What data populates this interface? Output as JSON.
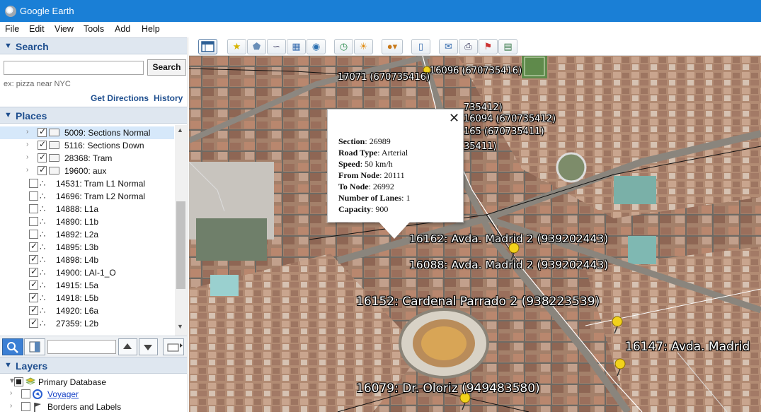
{
  "window": {
    "title": "Google Earth"
  },
  "menu": [
    "File",
    "Edit",
    "View",
    "Tools",
    "Add",
    "Help"
  ],
  "search": {
    "header": "Search",
    "input_value": "",
    "button": "Search",
    "hint": "ex: pizza near NYC",
    "get_directions": "Get Directions",
    "history": "History"
  },
  "places": {
    "header": "Places",
    "items": [
      {
        "label": "5009: Sections Normal",
        "checked": true,
        "kind": "folder",
        "expandable": true,
        "selected": true
      },
      {
        "label": "5116: Sections Down",
        "checked": true,
        "kind": "folder",
        "expandable": true
      },
      {
        "label": "28368: Tram",
        "checked": true,
        "kind": "folder",
        "expandable": true
      },
      {
        "label": "19600: aux",
        "checked": true,
        "kind": "folder",
        "expandable": true
      },
      {
        "label": "14531: Tram L1 Normal",
        "checked": false,
        "kind": "path"
      },
      {
        "label": "14696: Tram L2 Normal",
        "checked": false,
        "kind": "path"
      },
      {
        "label": "14888: L1a",
        "checked": false,
        "kind": "path"
      },
      {
        "label": "14890: L1b",
        "checked": false,
        "kind": "path"
      },
      {
        "label": "14892: L2a",
        "checked": false,
        "kind": "path"
      },
      {
        "label": "14895: L3b",
        "checked": true,
        "kind": "path"
      },
      {
        "label": "14898: L4b",
        "checked": true,
        "kind": "path"
      },
      {
        "label": "14900: LAI-1_O",
        "checked": true,
        "kind": "path"
      },
      {
        "label": "14915: L5a",
        "checked": true,
        "kind": "path"
      },
      {
        "label": "14918: L5b",
        "checked": true,
        "kind": "path"
      },
      {
        "label": "14920: L6a",
        "checked": true,
        "kind": "path"
      },
      {
        "label": "27359: L2b",
        "checked": true,
        "kind": "path"
      }
    ]
  },
  "layers": {
    "header": "Layers",
    "items": [
      {
        "label": "Primary Database",
        "checked": "partial",
        "link": false
      },
      {
        "label": "Voyager",
        "checked": false,
        "link": true
      },
      {
        "label": "Borders and Labels",
        "checked": false,
        "link": false
      }
    ]
  },
  "toolbar_icons": [
    "sidebar-toggle-icon",
    "placemark-icon",
    "polygon-icon",
    "path-icon",
    "image-overlay-icon",
    "record-tour-icon",
    "historical-imagery-icon",
    "sunlight-icon",
    "planets-icon",
    "ruler-icon",
    "email-icon",
    "print-icon",
    "view-in-maps-icon",
    "save-image-icon"
  ],
  "balloon": {
    "fields": [
      {
        "key": "Section",
        "value": "26989"
      },
      {
        "key": "Road Type",
        "value": "Arterial"
      },
      {
        "key": "Speed",
        "value": "50 km/h"
      },
      {
        "key": "From Node",
        "value": "20111"
      },
      {
        "key": "To Node",
        "value": "26992"
      },
      {
        "key": "Number of Lanes",
        "value": "1"
      },
      {
        "key": "Capacity",
        "value": "900"
      }
    ]
  },
  "map_labels": [
    {
      "text": "17071 (670735416)",
      "size": "small"
    },
    {
      "text": "16096 (670735416)",
      "size": "small"
    },
    {
      "text": "735412)",
      "size": "small"
    },
    {
      "text": "16094 (670735412)",
      "size": "small"
    },
    {
      "text": "165 (670735411)",
      "size": "small"
    },
    {
      "text": "35411)",
      "size": "small"
    },
    {
      "text": "16162: Avda. Madrid 2 (939202443)",
      "size": "medium"
    },
    {
      "text": "16088: Avda. Madrid 2 (939202443)",
      "size": "medium"
    },
    {
      "text": "16152: Cardenal Parrado 2 (938223539)",
      "size": "large"
    },
    {
      "text": "16147: Avda. Madrid",
      "size": "large"
    },
    {
      "text": "16079: Dr. Oloriz (949483580)",
      "size": "large"
    }
  ],
  "colors": {
    "titlebar": "#1a7fd6",
    "panel_header": "#dfe7f0",
    "pin": "#f2d21b",
    "header_text": "#1f4f8f"
  }
}
